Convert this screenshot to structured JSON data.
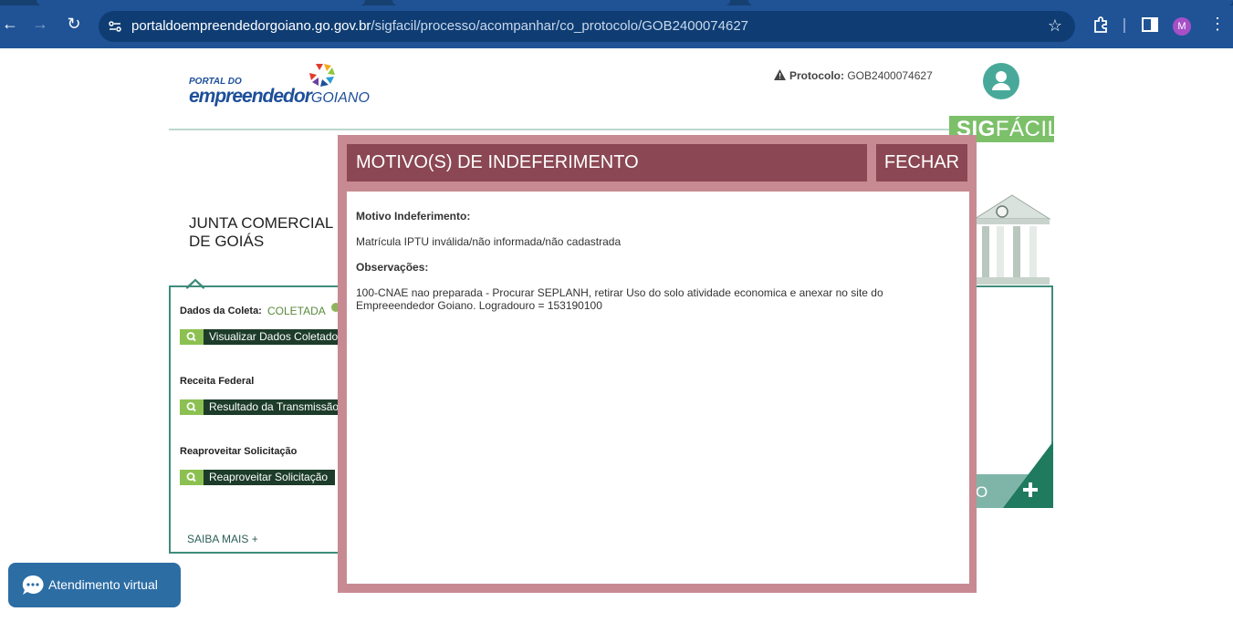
{
  "browser": {
    "url_host": "portaldoempreendedorgoiano.go.gov.br",
    "url_path": "/sigfacil/processo/acompanhar/co_protocolo/GOB2400074627",
    "profile_initial": "M"
  },
  "header": {
    "logo_line1": "PORTAL DO",
    "logo_line2_bold": "empreendedor",
    "logo_line2_thin": "GOIANO",
    "protocol_label": "Protocolo:",
    "protocol_value": "GOB2400074627",
    "sigfacil_bold": "SIG",
    "sigfacil_rest": "FÁCIL"
  },
  "left_panel": {
    "title": "JUNTA COMERCIAL DE GOIÁS",
    "coleta_label": "Dados da Coleta:",
    "coleta_status": "COLETADA",
    "btn_visualizar": "Visualizar Dados Coletados",
    "receita_label": "Receita Federal",
    "btn_resultado": "Resultado da Transmissão",
    "reaproveitar_label": "Reaproveitar Solicitação",
    "btn_reaproveitar": "Reaproveitar Solicitação",
    "saiba_mais": "SAIBA MAIS +"
  },
  "right_panel": {
    "corner_text": "O"
  },
  "modal": {
    "title": "MOTIVO(S) DE INDEFERIMENTO",
    "close_label": "FECHAR",
    "motivo_heading": "Motivo Indeferimento:",
    "motivo_text": "Matrícula IPTU inválida/não informada/não cadastrada",
    "obs_heading": "Observações:",
    "obs_text": "100-CNAE nao preparada - Procurar SEPLANH, retirar Uso do solo atividade economica e anexar no site do Empreeendedor Goiano. Logradouro = 153190100"
  },
  "chat": {
    "label": "Atendimento virtual"
  },
  "colors": {
    "browser_bar": "#1f5396",
    "modal_frame": "#c88a92",
    "modal_header": "#8b4753",
    "sigfacil_green": "#7cc06a",
    "teal": "#3f8c7c",
    "chat_blue": "#2c6da4"
  }
}
